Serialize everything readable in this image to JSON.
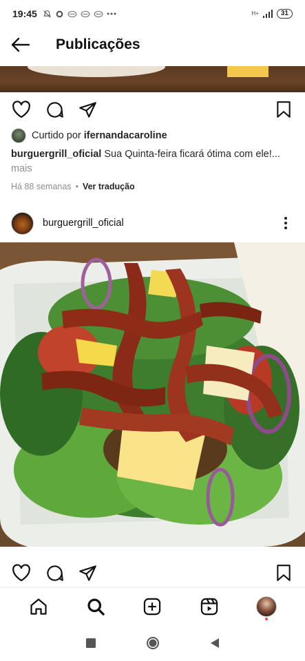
{
  "status_bar": {
    "time": "19:45",
    "network": "H+",
    "battery": "31",
    "notification_icons": [
      "muted-icon",
      "whatsapp-icon",
      "chat-icon",
      "chat-icon",
      "chat-icon",
      "more-notifications-icon"
    ]
  },
  "header": {
    "title": "Publicações"
  },
  "previous_post": {
    "liked_prefix": "Curtido por",
    "liked_user": "ifernandacaroline",
    "caption_user": "burguergrill_oficial",
    "caption_text": "Sua Quinta-feira ficará ótima com ele!...",
    "caption_more": "mais",
    "time_ago": "Há 88 semanas",
    "separator": "•",
    "translate_label": "Ver tradução"
  },
  "current_post": {
    "username": "burguergrill_oficial",
    "image_alt": "Salada com bacon, queijo e hambúrguer em embalagem de isopor"
  },
  "bottom_nav": {
    "items": [
      "home-icon",
      "search-icon",
      "new-post-icon",
      "reels-icon",
      "profile-avatar"
    ]
  },
  "colors": {
    "text": "#262626",
    "muted": "#8e8e8e",
    "notification": "#ed4956"
  }
}
